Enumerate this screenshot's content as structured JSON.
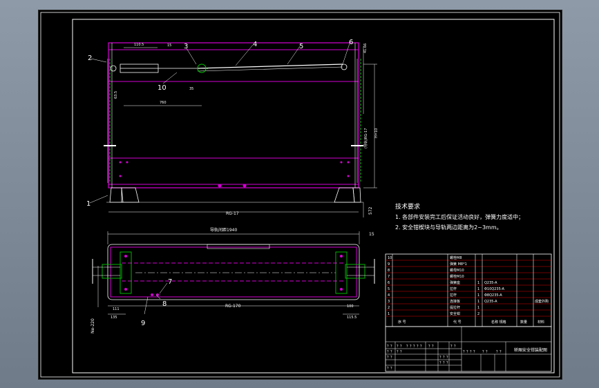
{
  "drawing": {
    "balloons": [
      "1",
      "2",
      "3",
      "4",
      "5",
      "6",
      "7",
      "8",
      "9",
      "10"
    ],
    "dims": {
      "d_110_5": "110.5",
      "d_15": "15",
      "d_760": "760",
      "d_35": "35",
      "d_63_5": "63.5",
      "d_41_66": "41.66",
      "d_rg17": "RG-17",
      "d_vert_mid": "(导轨)RG-17",
      "d_h": "H=10",
      "d_572": "572",
      "d_top_total": "导轨间距1940",
      "d_15b": "15",
      "d_rg170": "RG-170",
      "d_100": "100",
      "d_111": "111",
      "d_135": "135",
      "d_115_5": "115.5",
      "d_left_vert": "Ne-220"
    }
  },
  "notes": {
    "heading": "技术要求",
    "line1": "1. 各部件安装完工后保证活动良好，弹簧力度适中；",
    "line2": "2. 安全钳楔块与导轨两边距离为2~3mm。"
  },
  "bom": {
    "rows": [
      {
        "no": "10",
        "name": "螺栓M8",
        "qty": "",
        "mat": ""
      },
      {
        "no": "9",
        "name": "弹簧 M8*1",
        "qty": "",
        "mat": ""
      },
      {
        "no": "8",
        "name": "螺母M10",
        "qty": "",
        "mat": ""
      },
      {
        "no": "7",
        "name": "螺栓M10",
        "qty": "",
        "mat": ""
      },
      {
        "no": "6",
        "name": "弹簧座",
        "qty": "1",
        "mat": "Q235-A"
      },
      {
        "no": "5",
        "name": "拉杆",
        "qty": "1",
        "mat": "Φ10Q235-A"
      },
      {
        "no": "4",
        "name": "拉杆",
        "qty": "1",
        "mat": "Φ8Q235-A"
      },
      {
        "no": "3",
        "name": "连接板",
        "qty": "1",
        "mat": "Q235-A"
      },
      {
        "no": "2",
        "name": "提拉杆",
        "qty": "1",
        "mat": ""
      },
      {
        "no": "1",
        "name": "安全钳",
        "qty": "2",
        "mat": ""
      }
    ],
    "side_label": "成套外购",
    "header": {
      "no": "序 号",
      "code": "代 号",
      "name": "名称 规格",
      "qty": "数量",
      "mat": "材料"
    }
  },
  "title_block": {
    "title": "轿厢安全钳装配图",
    "row_a": [
      "？？",
      "？？",
      "？？？？？",
      "？？",
      "？？"
    ],
    "row_b": [
      "？？",
      "？？",
      "？？？？",
      "？？",
      "？？"
    ],
    "row_c": [
      "？？",
      "？？？",
      "？？？"
    ],
    "row_d": [
      "？？"
    ]
  }
}
